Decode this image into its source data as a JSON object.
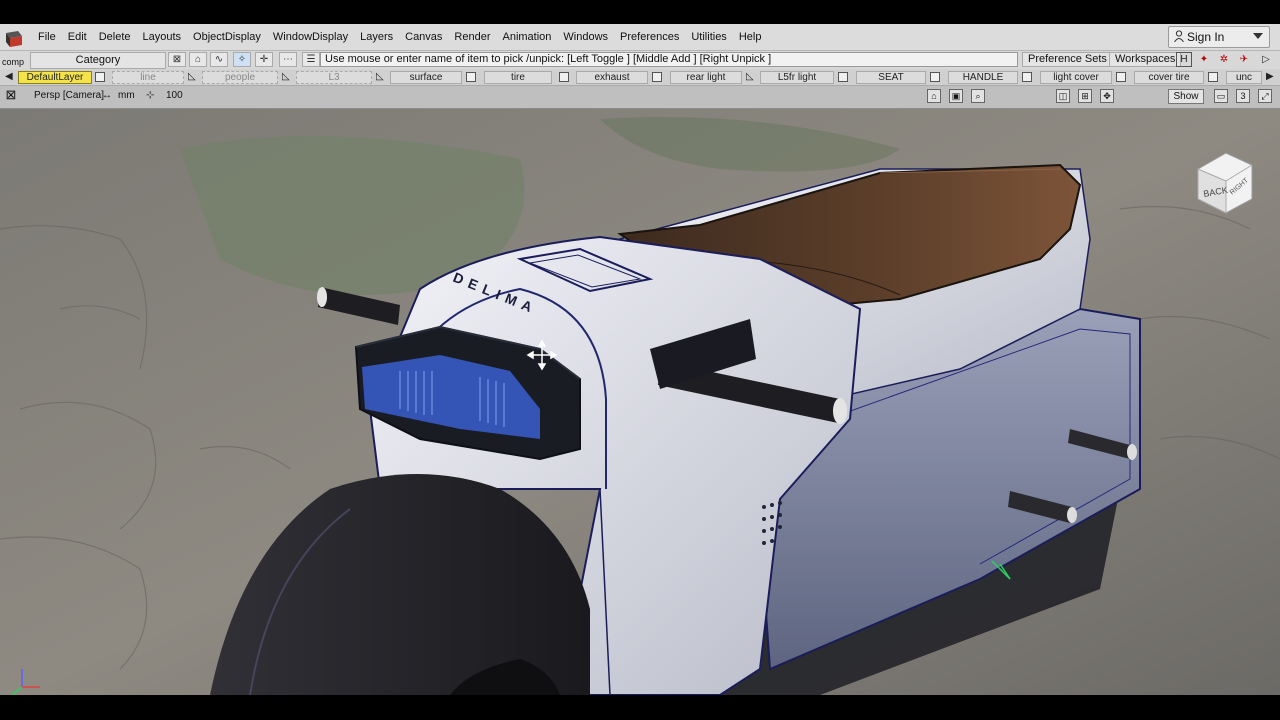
{
  "menu": {
    "items": [
      "File",
      "Edit",
      "Delete",
      "Layouts",
      "ObjectDisplay",
      "WindowDisplay",
      "Layers",
      "Canvas",
      "Render",
      "Animation",
      "Windows",
      "Preferences",
      "Utilities",
      "Help"
    ],
    "sign_in": "Sign In"
  },
  "toolbar": {
    "comp_label": "comp",
    "category": "Category",
    "prompt": "Use mouse or enter name of item to pick /unpick: [Left Toggle ] [Middle Add ] [Right Unpick ]",
    "preference_sets": "Preference Sets",
    "workspaces": "Workspaces"
  },
  "layers": {
    "items": [
      "DefaultLayer",
      "line",
      "people",
      "L3",
      "surface",
      "tire",
      "exhaust",
      "rear light",
      "L5fr light",
      "SEAT",
      "HANDLE",
      "light cover",
      "cover tire",
      "unc"
    ]
  },
  "viewport": {
    "camera": "Persp [Camera]",
    "units": "mm",
    "scale": "100",
    "show": "Show",
    "pane_count": "3",
    "viewcube_back": "BACK",
    "viewcube_right": "RIGHT",
    "brand_text": "DELIMA"
  },
  "colors": {
    "active_layer": "#f4e44a",
    "seat": "#5a3d2a",
    "body": "#e9e9ef"
  }
}
